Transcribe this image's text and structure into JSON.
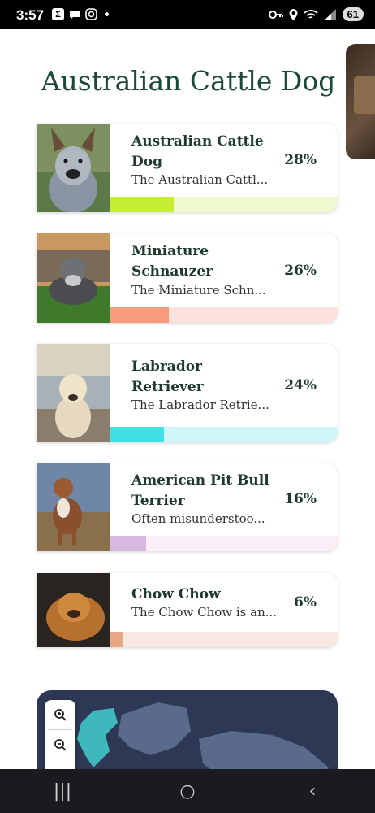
{
  "status": {
    "time": "3:57",
    "battery": "61"
  },
  "page": {
    "title": "Australian Cattle Dog"
  },
  "results": [
    {
      "name": "Australian Cattle Dog",
      "percent": "28%",
      "description": "The Australian Cattl...",
      "bar_color": "#c7ee35",
      "track_color": "#effad0",
      "fill_fraction": 0.28
    },
    {
      "name": "Miniature Schnauzer",
      "percent": "26%",
      "description": "The Miniature Schn...",
      "bar_color": "#f79b7f",
      "track_color": "#fde2dc",
      "fill_fraction": 0.26
    },
    {
      "name": "Labrador Retriever",
      "percent": "24%",
      "description": "The Labrador Retrie...",
      "bar_color": "#3ee0e6",
      "track_color": "#cff6f8",
      "fill_fraction": 0.24
    },
    {
      "name": "American Pit Bull Terrier",
      "percent": "16%",
      "description": "Often misunderstoo...",
      "bar_color": "#d9b8e1",
      "track_color": "#fbeef6",
      "fill_fraction": 0.16
    },
    {
      "name": "Chow Chow",
      "percent": "6%",
      "description": "The Chow Chow is an...",
      "bar_color": "#e5a784",
      "track_color": "#f7e9e1",
      "fill_fraction": 0.06
    }
  ],
  "map": {
    "zoom_in_icon": "zoom-in-icon",
    "zoom_out_icon": "zoom-out-icon"
  },
  "nav": {
    "recents": "|||",
    "home": "○",
    "back": "‹"
  }
}
